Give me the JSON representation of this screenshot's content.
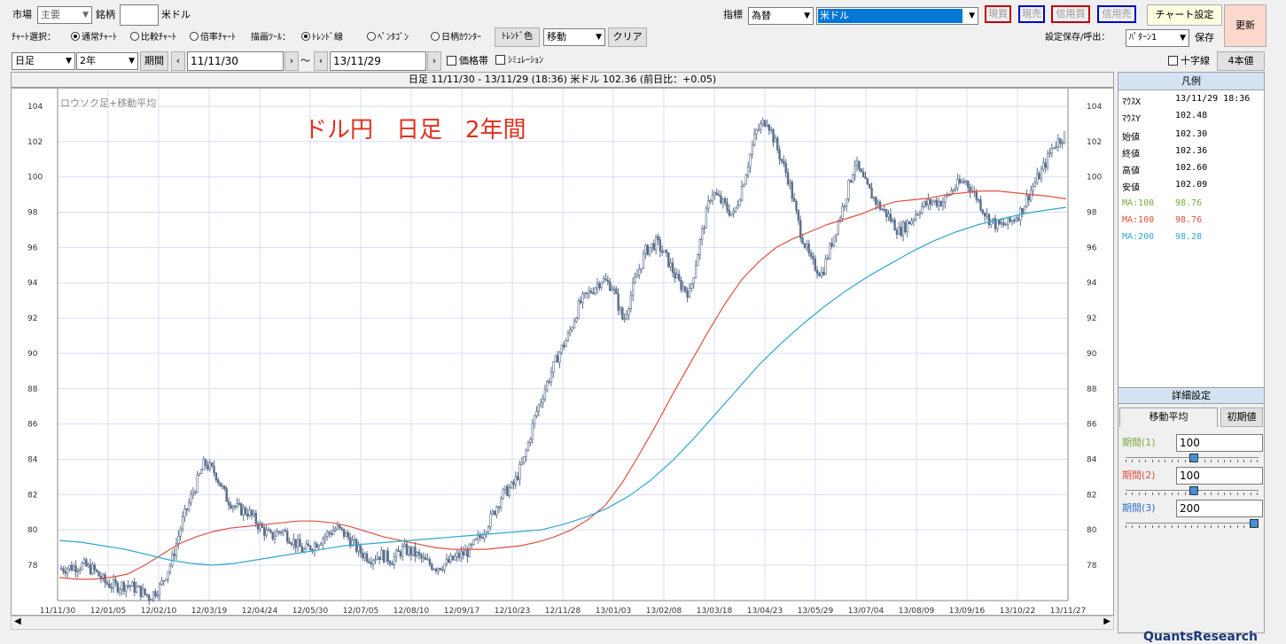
{
  "toolbar1": {
    "market_label": "市場",
    "market_value": "主要",
    "symbol_label": "銘柄",
    "symbol_value": "",
    "symbol_name": "米ドル",
    "indicator_label": "指標",
    "indicator_value": "為替",
    "indicator_symbol": "米ドル",
    "order_buttons": [
      {
        "label": "現買",
        "color": "#c00000"
      },
      {
        "label": "現売",
        "color": "#0000c0"
      },
      {
        "label": "信用買",
        "color": "#c00000"
      },
      {
        "label": "信用売",
        "color": "#0000c0"
      }
    ],
    "chart_settings": "チャート設定",
    "refresh": "更新"
  },
  "toolbar2": {
    "chart_select_label": "ﾁｬｰﾄ選択：",
    "chart_types": [
      {
        "label": "通常ﾁｬｰﾄ",
        "selected": true
      },
      {
        "label": "比較ﾁｬｰﾄ",
        "selected": false
      },
      {
        "label": "倍率ﾁｬｰﾄ",
        "selected": false
      }
    ],
    "draw_tool_label": "描画ﾂｰﾙ：",
    "draw_tools": [
      {
        "label": "ﾄﾚﾝﾄﾞ線",
        "selected": true
      },
      {
        "label": "ﾍﾟﾝﾀｺﾞﾝ",
        "selected": false
      },
      {
        "label": "日柄ｶｳﾝﾀｰ",
        "selected": false
      }
    ],
    "trend_color": "ﾄﾚﾝﾄﾞ色",
    "move_value": "移動",
    "clear": "クリア",
    "save_label": "設定保存/呼出：",
    "pattern_value": "ﾊﾟﾀｰﾝ1",
    "save": "保存"
  },
  "toolbar3": {
    "period_type": "日足",
    "span": "2年",
    "period_btn": "期間",
    "start_date": "11/11/30",
    "tilde": "〜",
    "end_date": "13/11/29",
    "price_band": "価格帯",
    "simulation": "ｼﾐｭﾚｰｼｮﾝ",
    "crosshair": "十字線",
    "four_values": "4本値"
  },
  "chart_header": "日足 11/11/30 - 13/11/29 (18:36)  米ドル  102.36 (前日比：+0.05)",
  "chart_data": {
    "type": "line",
    "title": "ドル円　日足　2年間",
    "series_caption": "ロウソク足+移動平均",
    "ylim": [
      76,
      104
    ],
    "y_ticks": [
      104,
      102,
      100,
      98,
      96,
      94,
      92,
      90,
      88,
      86,
      84,
      82,
      80,
      78
    ],
    "x_ticks": [
      "11/11/30",
      "12/01/05",
      "12/02/10",
      "12/03/19",
      "12/04/24",
      "12/05/30",
      "12/07/05",
      "12/08/10",
      "12/09/17",
      "12/10/23",
      "12/11/28",
      "13/01/03",
      "13/02/08",
      "13/03/18",
      "13/04/23",
      "13/05/29",
      "13/07/04",
      "13/08/09",
      "13/09/16",
      "13/10/22",
      "13/11/27"
    ],
    "series": [
      {
        "name": "price",
        "color": "#5a6e8c",
        "values": [
          77.8,
          77.9,
          78.0,
          77.7,
          77.0,
          76.8,
          76.9,
          76.6,
          76.2,
          76.8,
          78.2,
          80.5,
          82.2,
          83.8,
          83.2,
          81.8,
          81.2,
          81.0,
          80.2,
          79.6,
          80.0,
          79.4,
          78.8,
          79.2,
          79.7,
          80.1,
          79.6,
          78.8,
          78.4,
          78.6,
          78.3,
          78.9,
          78.7,
          78.2,
          77.9,
          78.1,
          78.5,
          78.8,
          79.6,
          80.7,
          82.0,
          82.5,
          84.0,
          86.5,
          88.2,
          89.8,
          91.0,
          92.8,
          93.5,
          94.2,
          93.8,
          91.8,
          94.0,
          95.8,
          96.3,
          95.3,
          94.0,
          93.4,
          96.5,
          99.2,
          98.5,
          97.8,
          100.0,
          102.5,
          103.3,
          101.5,
          99.8,
          97.0,
          95.2,
          94.5,
          96.5,
          98.5,
          100.8,
          99.5,
          98.5,
          97.8,
          96.9,
          97.5,
          98.3,
          98.6,
          98.6,
          99.4,
          99.8,
          98.9,
          97.7,
          97.2,
          97.4,
          98.0,
          99.3,
          100.4,
          101.8,
          102.36
        ]
      },
      {
        "name": "MA:100",
        "color": "#e05040",
        "values": [
          77.3,
          77.2,
          77.2,
          77.3,
          77.5,
          78.0,
          78.6,
          79.2,
          79.6,
          79.9,
          80.1,
          80.2,
          80.3,
          80.4,
          80.5,
          80.5,
          80.4,
          80.2,
          79.9,
          79.6,
          79.4,
          79.2,
          79.0,
          78.9,
          78.9,
          78.9,
          79.0,
          79.1,
          79.3,
          79.6,
          80.0,
          80.6,
          81.4,
          82.7,
          84.3,
          86.0,
          87.8,
          89.5,
          91.2,
          92.8,
          94.2,
          95.2,
          96.0,
          96.5,
          96.9,
          97.3,
          97.6,
          97.9,
          98.3,
          98.6,
          98.7,
          98.8,
          99.0,
          99.1,
          99.2,
          99.2,
          99.1,
          99.0,
          98.9,
          98.76
        ]
      },
      {
        "name": "MA:200",
        "color": "#30a8cc",
        "values": [
          79.4,
          79.3,
          79.1,
          78.9,
          78.6,
          78.3,
          78.1,
          78.0,
          78.1,
          78.3,
          78.5,
          78.7,
          78.9,
          79.1,
          79.2,
          79.3,
          79.4,
          79.5,
          79.6,
          79.7,
          79.8,
          79.9,
          80.0,
          80.3,
          80.7,
          81.2,
          81.9,
          82.8,
          83.9,
          85.2,
          86.6,
          88.0,
          89.4,
          90.6,
          91.7,
          92.7,
          93.6,
          94.4,
          95.1,
          95.8,
          96.4,
          96.9,
          97.3,
          97.6,
          97.9,
          98.1,
          98.28
        ]
      }
    ]
  },
  "legend": {
    "title": "凡例",
    "rows": [
      {
        "k": "ﾏｳｽX",
        "v": "13/11/29 18:36"
      },
      {
        "k": "ﾏｳｽY",
        "v": "102.48"
      },
      {
        "k": "始値",
        "v": "102.30"
      },
      {
        "k": "終値",
        "v": "102.36"
      },
      {
        "k": "高値",
        "v": "102.60"
      },
      {
        "k": "安値",
        "v": "102.09"
      }
    ],
    "ma": [
      {
        "k": "MA:100",
        "v": "98.76",
        "color": "#7aaa3a"
      },
      {
        "k": "MA:100",
        "v": "98.76",
        "color": "#e05040"
      },
      {
        "k": "MA:200",
        "v": "98.28",
        "color": "#30a8cc"
      }
    ]
  },
  "detail": {
    "title": "詳細設定",
    "tab_ma": "移動平均",
    "init_btn": "初期値",
    "params": [
      {
        "label": "期間(1)",
        "value": "100",
        "color": "#7aaa3a",
        "pos": 0.5
      },
      {
        "label": "期間(2)",
        "value": "100",
        "color": "#e05040",
        "pos": 0.5
      },
      {
        "label": "期間(3)",
        "value": "200",
        "color": "#3070c0",
        "pos": 1.0
      }
    ]
  },
  "brand": "QuantsResearch"
}
